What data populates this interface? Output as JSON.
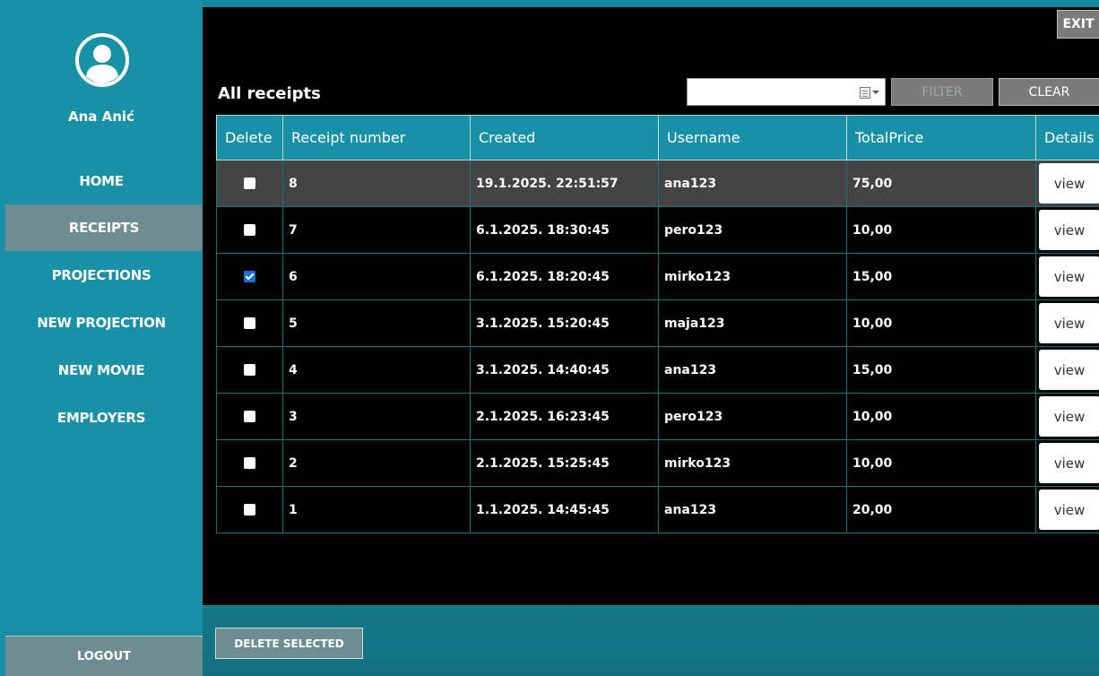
{
  "sidebar": {
    "user_name": "Ana Anić",
    "items": [
      {
        "label": "HOME",
        "active": false
      },
      {
        "label": "RECEIPTS",
        "active": true
      },
      {
        "label": "PROJECTIONS",
        "active": false
      },
      {
        "label": "NEW PROJECTION",
        "active": false
      },
      {
        "label": "NEW MOVIE",
        "active": false
      },
      {
        "label": "EMPLOYERS",
        "active": false
      }
    ],
    "logout_label": "LOGOUT"
  },
  "header": {
    "exit_label": "EXIT",
    "title": "All receipts",
    "filter_date_value": "",
    "filter_label": "FILTER",
    "clear_label": "CLEAR"
  },
  "table": {
    "columns": [
      "Delete",
      "Receipt number",
      "Created",
      "Username",
      "TotalPrice",
      "Details"
    ],
    "view_label": "view",
    "rows": [
      {
        "checked": false,
        "selected": true,
        "number": "8",
        "created": "19.1.2025. 22:51:57",
        "username": "ana123",
        "total": "75,00"
      },
      {
        "checked": false,
        "selected": false,
        "number": "7",
        "created": "6.1.2025. 18:30:45",
        "username": "pero123",
        "total": "10,00"
      },
      {
        "checked": true,
        "selected": false,
        "number": "6",
        "created": "6.1.2025. 18:20:45",
        "username": "mirko123",
        "total": "15,00"
      },
      {
        "checked": false,
        "selected": false,
        "number": "5",
        "created": "3.1.2025. 15:20:45",
        "username": "maja123",
        "total": "10,00"
      },
      {
        "checked": false,
        "selected": false,
        "number": "4",
        "created": "3.1.2025. 14:40:45",
        "username": "ana123",
        "total": "15,00"
      },
      {
        "checked": false,
        "selected": false,
        "number": "3",
        "created": "2.1.2025. 16:23:45",
        "username": "pero123",
        "total": "10,00"
      },
      {
        "checked": false,
        "selected": false,
        "number": "2",
        "created": "2.1.2025. 15:25:45",
        "username": "mirko123",
        "total": "10,00"
      },
      {
        "checked": false,
        "selected": false,
        "number": "1",
        "created": "1.1.2025. 14:45:45",
        "username": "ana123",
        "total": "20,00"
      }
    ]
  },
  "footer": {
    "delete_selected_label": "DELETE SELECTED"
  },
  "colors": {
    "sidebar": "#1890a5",
    "active_nav": "#6e8d93",
    "table_header": "#1890a5",
    "selected_row": "#444444",
    "checkbox_checked": "#1a73d4"
  }
}
